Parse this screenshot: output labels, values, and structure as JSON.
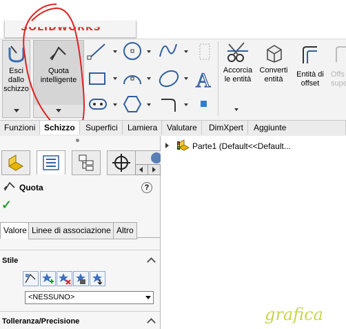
{
  "app": {
    "logo_text": "SOLIDWORKS"
  },
  "ribbon": {
    "exit_sketch": {
      "label": "Esci dallo schizzo"
    },
    "smart_dimension": {
      "label": "Quota intelligente"
    },
    "trim": {
      "label": "Accorcia le entità"
    },
    "convert": {
      "label": "Converti entità"
    },
    "offset": {
      "label": "Entità di offset"
    },
    "offset_surface": {
      "label": "Offs supe"
    },
    "tools": [
      "line-icon",
      "circle-icon",
      "spline-icon",
      "construction-geometry-icon",
      "rectangle-icon",
      "arc-icon",
      "ellipse-icon",
      "text-icon",
      "slot-icon",
      "polygon-icon",
      "fillet-icon",
      "point-icon"
    ]
  },
  "tabs": [
    {
      "label": "Funzioni"
    },
    {
      "label": "Schizzo",
      "active": true
    },
    {
      "label": "Superfici"
    },
    {
      "label": "Lamiera"
    },
    {
      "label": "Valutare"
    },
    {
      "label": "DimXpert"
    },
    {
      "label": "Aggiunte SOLIDWORKS"
    }
  ],
  "panel": {
    "tab_icons": [
      "feature-manager-icon",
      "property-manager-icon",
      "configuration-manager-icon",
      "dimxpert-manager-icon",
      "display-manager-icon"
    ],
    "title": "Quota",
    "help": "?",
    "ok_symbol": "✓",
    "subtabs": [
      {
        "label": "Valore",
        "active": true
      },
      {
        "label": "Linee di associazione"
      },
      {
        "label": "Altro"
      }
    ],
    "style_section": {
      "title": "Stile",
      "select_value": "<NESSUNO>"
    },
    "tolerance_section": {
      "title": "Tolleranza/Precisione"
    }
  },
  "tree": {
    "root_label": "Parte1  (Default<<Default..."
  },
  "watermark": {
    "text": "grafica"
  },
  "colors": {
    "annotation_red": "#e0201e",
    "check_green": "#2aa02a",
    "ribbon_bg": "#f3f3f3"
  }
}
